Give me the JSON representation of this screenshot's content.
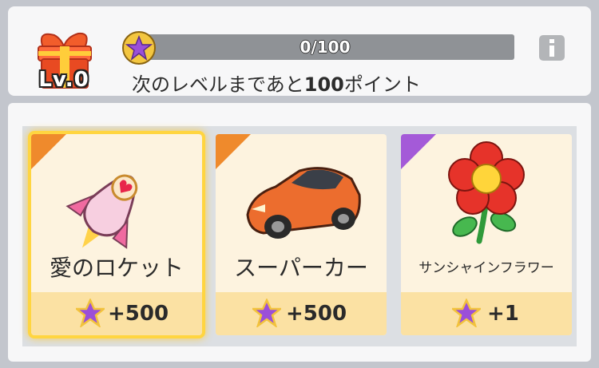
{
  "header": {
    "level_label": "Lv.0",
    "progress": {
      "current": 0,
      "max": 100,
      "text": "0/100"
    },
    "hint_prefix": "次のレベルまであと",
    "hint_points": "100",
    "hint_suffix": "ポイント",
    "info_icon": "info-icon",
    "gift_icon": "gift-box-icon"
  },
  "rewards": [
    {
      "name": "愛のロケット",
      "cost": "+500",
      "rarity_color": "#ef8a2c",
      "selected": true,
      "icon": "rocket-icon"
    },
    {
      "name": "スーパーカー",
      "cost": "+500",
      "rarity_color": "#ef8a2c",
      "selected": false,
      "icon": "sports-car-icon"
    },
    {
      "name": "サンシャインフラワー",
      "cost": "+1",
      "rarity_color": "#a45ad8",
      "selected": false,
      "icon": "flower-icon"
    }
  ],
  "colors": {
    "progress_fill": "#f0b623",
    "star_purple": "#9b4fd8",
    "star_gold": "#f2c23c"
  }
}
